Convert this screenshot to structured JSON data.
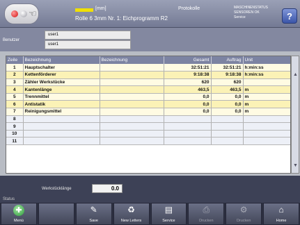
{
  "header": {
    "unit": "[mm]",
    "protocol_title": "Protokolle",
    "roll_info": "Rolle 6 3mm Nr. 1: Eichprogramm R2",
    "status_lines": [
      "MASCHINENSTATUS",
      "SENSOREN OK",
      "Service"
    ],
    "help": "?"
  },
  "user": {
    "label": "Benutzer",
    "field1": "user1",
    "field2": "user1"
  },
  "table": {
    "columns": [
      "Zeile",
      "Bezeichnung",
      "Bezeichnung",
      "Gesamt",
      "Auftrag",
      "Unit"
    ],
    "rows": [
      [
        "1",
        "Hauptschalter",
        "",
        "32:51:21",
        "32:51:21",
        "h:min:ss"
      ],
      [
        "2",
        "Kettenförderer",
        "",
        "9:18:38",
        "9:18:38",
        "h:min:ss"
      ],
      [
        "3",
        "Zähler Werkstücke",
        "",
        "620",
        "620",
        ""
      ],
      [
        "4",
        "Kantenlänge",
        "",
        "463,5",
        "463,5",
        "m"
      ],
      [
        "5",
        "Trennmittel",
        "",
        "0,0",
        "0,0",
        "m"
      ],
      [
        "6",
        "Antistatik",
        "",
        "0,0",
        "0,0",
        "m"
      ],
      [
        "7",
        "Reinigungsmittel",
        "",
        "0,0",
        "0,0",
        "m"
      ],
      [
        "8",
        "",
        "",
        "",
        "",
        ""
      ],
      [
        "9",
        "",
        "",
        "",
        "",
        ""
      ],
      [
        "10",
        "",
        "",
        "",
        "",
        ""
      ],
      [
        "11",
        "",
        "",
        "",
        "",
        ""
      ]
    ]
  },
  "status": {
    "weight_label": "Werkstücklänge",
    "weight_value": "0.0",
    "label": "Status"
  },
  "toolbar": [
    {
      "icon": "✚",
      "label": "Menü",
      "disabled": false
    },
    {
      "icon": "",
      "label": "",
      "disabled": false
    },
    {
      "icon": "✎",
      "label": "Save",
      "disabled": false
    },
    {
      "icon": "♻",
      "label": "New Letters",
      "disabled": false
    },
    {
      "icon": "▤",
      "label": "Service",
      "disabled": false
    },
    {
      "icon": "⎙",
      "label": "Drucken",
      "disabled": true
    },
    {
      "icon": "⚙",
      "label": "Drucken",
      "disabled": true
    },
    {
      "icon": "⌂",
      "label": "Home",
      "disabled": false
    }
  ]
}
